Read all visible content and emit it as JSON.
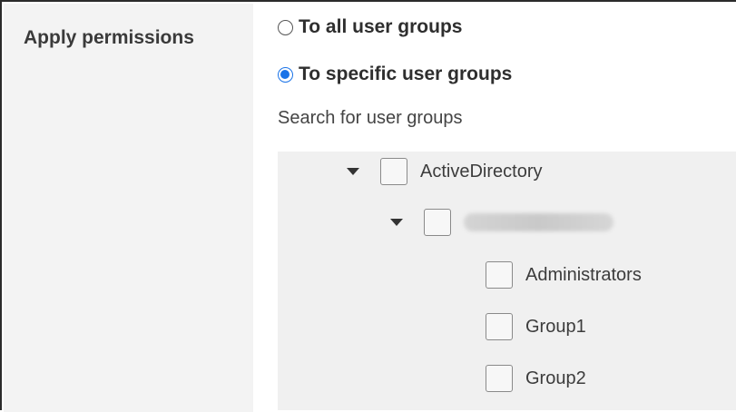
{
  "section": {
    "label": "Apply permissions"
  },
  "options": {
    "all_groups": {
      "label": "To all user groups",
      "checked": false
    },
    "specific_groups": {
      "label": "To specific user groups",
      "checked": true
    }
  },
  "search": {
    "label": "Search for user groups"
  },
  "tree": {
    "root": {
      "label": "ActiveDirectory",
      "expanded": true,
      "checked": false
    },
    "domain": {
      "label": "",
      "expanded": true,
      "checked": false,
      "redacted": true
    },
    "groups": [
      {
        "label": "Administrators",
        "checked": false
      },
      {
        "label": "Group1",
        "checked": false
      },
      {
        "label": "Group2",
        "checked": false
      }
    ]
  },
  "colors": {
    "accent": "#1a73e8",
    "left_column_bg": "#f3f3f3",
    "tree_bg": "#f0f0f0"
  }
}
